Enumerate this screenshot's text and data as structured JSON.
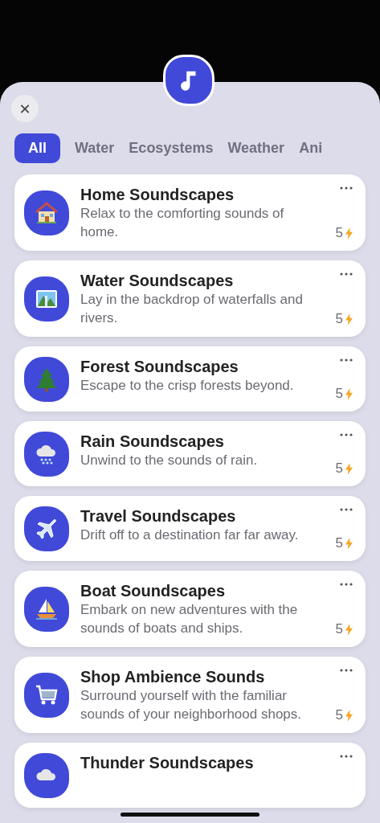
{
  "close_button": {
    "label": "✕"
  },
  "tabs": [
    {
      "label": "All",
      "selected": true
    },
    {
      "label": "Water",
      "selected": false
    },
    {
      "label": "Ecosystems",
      "selected": false
    },
    {
      "label": "Weather",
      "selected": false
    },
    {
      "label": "Ani",
      "selected": false
    }
  ],
  "cards": [
    {
      "kind": "house",
      "title": "Home Soundscapes",
      "description": "Relax to the comforting sounds of home.",
      "count": "5"
    },
    {
      "kind": "landscape",
      "title": "Water Soundscapes",
      "description": "Lay in the backdrop of waterfalls and rivers.",
      "count": "5"
    },
    {
      "kind": "tree",
      "title": "Forest Soundscapes",
      "description": "Escape to the crisp forests beyond.",
      "count": "5"
    },
    {
      "kind": "rain",
      "title": "Rain Soundscapes",
      "description": "Unwind to the sounds of rain.",
      "count": "5"
    },
    {
      "kind": "plane",
      "title": "Travel Soundscapes",
      "description": "Drift off to a destination far far away.",
      "count": "5"
    },
    {
      "kind": "boat",
      "title": "Boat Soundscapes",
      "description": "Embark on new adventures with the sounds of boats and ships.",
      "count": "5"
    },
    {
      "kind": "cart",
      "title": "Shop Ambience Sounds",
      "description": "Surround yourself with the familiar sounds of your neighborhood shops.",
      "count": "5"
    },
    {
      "kind": "cloud",
      "title": "Thunder Soundscapes"
    }
  ]
}
